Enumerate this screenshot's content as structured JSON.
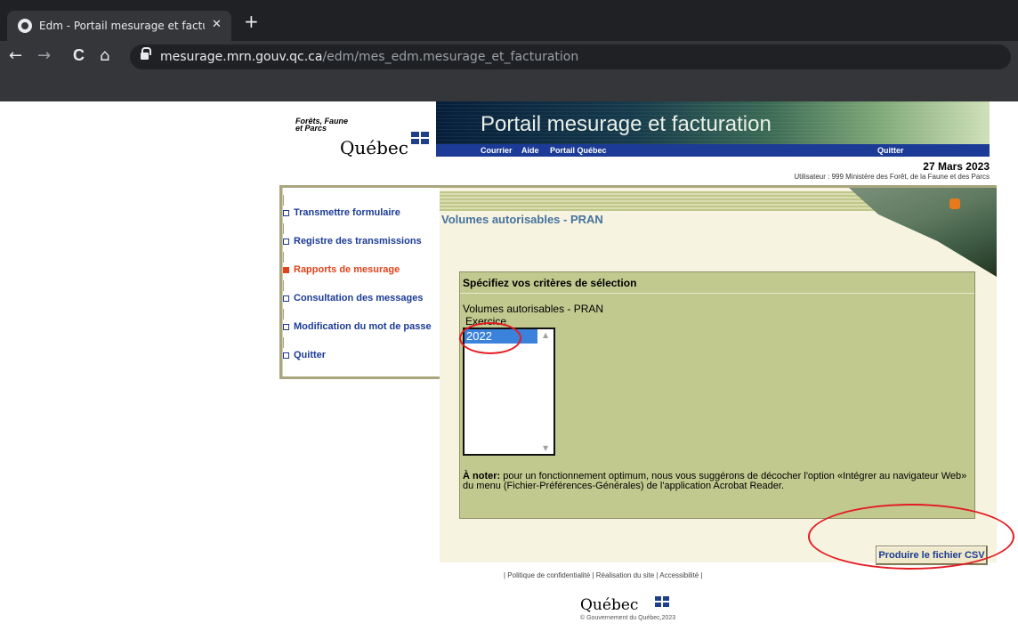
{
  "browser": {
    "tab_title": "Edm - Portail mesurage et factura",
    "tab_close": "✕",
    "new_tab": "+",
    "back": "←",
    "forward": "→",
    "reload": "C",
    "home": "⌂",
    "url_host": "mesurage.mrn.gouv.qc.ca",
    "url_path": "/edm/mes_edm.mesurage_et_facturation"
  },
  "header": {
    "logo_line1": "Forêts, Faune",
    "logo_line2": "et Parcs",
    "logo_quebec": "Québec",
    "banner_title": "Portail mesurage et facturation",
    "nav": {
      "courrier": "Courrier",
      "aide": "Aide",
      "portail_quebec": "Portail Québec",
      "quitter": "Quitter"
    },
    "date": "27 Mars 2023",
    "user": "Utilisateur : 999 Ministère des Forêt, de la Faune et des Parcs"
  },
  "menu": {
    "items": [
      {
        "label": "Transmettre formulaire"
      },
      {
        "label": "Registre des transmissions"
      },
      {
        "label": "Rapports de mesurage"
      },
      {
        "label": "Consultation des messages"
      },
      {
        "label": "Modification du mot de passe"
      },
      {
        "label": "Quitter"
      }
    ]
  },
  "content": {
    "title": "Volumes autorisables - PRAN",
    "criteria_header": "Spécifiez vos critères de sélection",
    "report_name": "Volumes autorisables - PRAN",
    "field_label": "Exercice",
    "selected_option": "2022",
    "note_bold": "À noter:",
    "note_text": " pour un fonctionnement optimum, nous vous suggérons de décocher l'option «Intégrer au navigateur Web» du menu (Fichier-Préférences-Générales) de l'application Acrobat Reader.",
    "csv_button": "Produire le fichier CSV"
  },
  "footer": {
    "links": "| Politique de confidentialité | Réalisation du site | Accessibilité |",
    "logo": "Québec",
    "copyright": "© Gouvernement du Québec,2023"
  },
  "colors": {
    "accent_blue": "#1b3b96",
    "active_orange": "#e0421b",
    "panel_green": "#c1c98f",
    "annotation_red": "#e31b23"
  }
}
